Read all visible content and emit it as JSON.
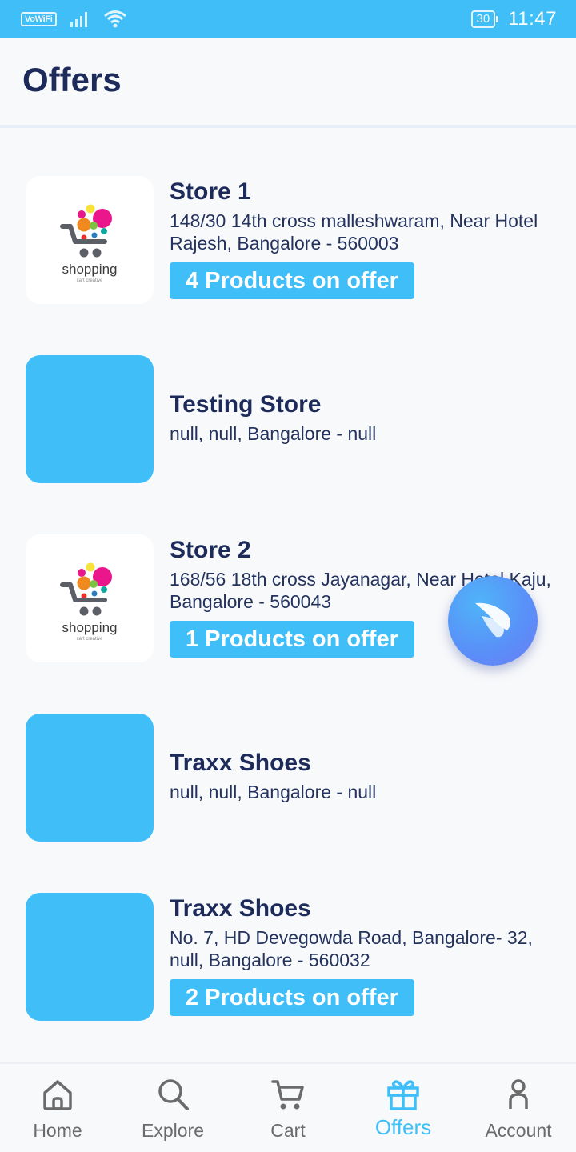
{
  "status_bar": {
    "network_label": "VoWiFi",
    "battery": "30",
    "time": "11:47"
  },
  "header": {
    "title": "Offers"
  },
  "stores": [
    {
      "name": "Store 1",
      "address": "148/30 14th cross malleshwaram, Near Hotel Rajesh, Bangalore - 560003",
      "offer_badge": "4 Products on offer",
      "logo_text": "shopping",
      "logo_subtext": "cart creative"
    },
    {
      "name": "Testing Store",
      "address": "null, null, Bangalore - null"
    },
    {
      "name": "Store 2",
      "address": "168/56 18th cross Jayanagar, Near Hotel Kaju, Bangalore - 560043",
      "offer_badge": "1 Products on offer",
      "logo_text": "shopping",
      "logo_subtext": "cart creative"
    },
    {
      "name": "Traxx Shoes",
      "address": "null, null, Bangalore - null"
    },
    {
      "name": "Traxx Shoes",
      "address": "No. 7, HD Devegowda Road, Bangalore- 32, null, Bangalore - 560032",
      "offer_badge": "2 Products on offer"
    }
  ],
  "bottom_nav": [
    {
      "label": "Home",
      "icon": "home-icon",
      "active": false
    },
    {
      "label": "Explore",
      "icon": "search-icon",
      "active": false
    },
    {
      "label": "Cart",
      "icon": "cart-icon",
      "active": false
    },
    {
      "label": "Offers",
      "icon": "gift-icon",
      "active": true
    },
    {
      "label": "Account",
      "icon": "person-icon",
      "active": false
    }
  ],
  "colors": {
    "accent": "#3FBEF8",
    "title": "#1D2B5A",
    "background": "#F8F9FB"
  }
}
